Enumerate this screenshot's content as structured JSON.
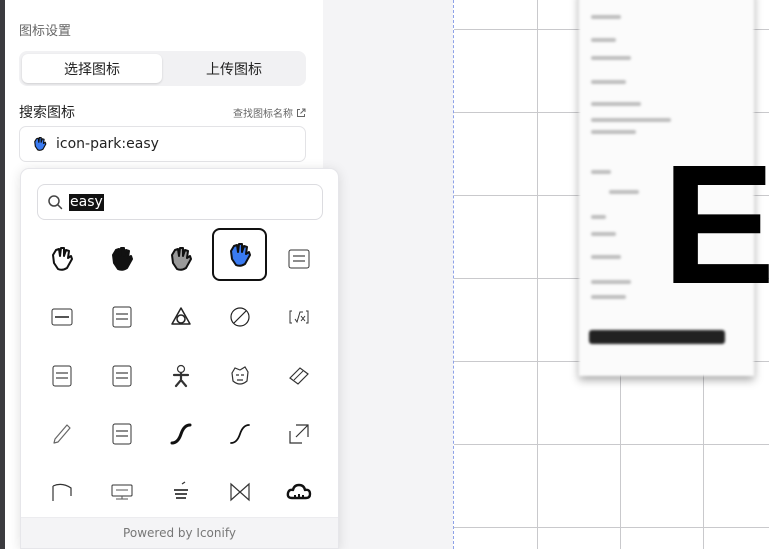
{
  "panel": {
    "section_title": "图标设置",
    "tabs": [
      {
        "label": "选择图标",
        "active": true
      },
      {
        "label": "上传图标",
        "active": false
      }
    ],
    "search_label": "搜索图标",
    "find_link": "查找图标名称",
    "selected_icon": {
      "icon": "hand-easy-icon",
      "value": "icon-park:easy",
      "color": "#3a7bf2"
    }
  },
  "popup": {
    "search_value": "easy",
    "search_icon": "search-icon",
    "icons": [
      "hand-outline-icon",
      "hand-filled-icon",
      "hand-gray-icon",
      "hand-blue-icon",
      "easy-box-icon",
      "easy-label-icon",
      "mth-easy-icon",
      "triangle-loop-icon",
      "slash-circle-icon",
      "formula-icon",
      "ldch-easy-icon",
      "ldch-easy-alt-icon",
      "gingerbread-icon",
      "face-sketch-icon",
      "eraser-icon",
      "pencil-icon",
      "snmr-easy-icon",
      "curve-bold-icon",
      "curve-thin-icon",
      "arrow-box-icon",
      "flag-icon",
      "eft-label-icon",
      "bowl-icon",
      "split-triangle-icon",
      "cloud-icon"
    ],
    "selected_index": 3,
    "footer": "Powered by Iconify"
  },
  "canvas": {
    "big_text": "Ea"
  },
  "colors": {
    "accent": "#3a7bf2",
    "selection_border": "#111111",
    "canvas_guide": "#8ea2e8"
  }
}
